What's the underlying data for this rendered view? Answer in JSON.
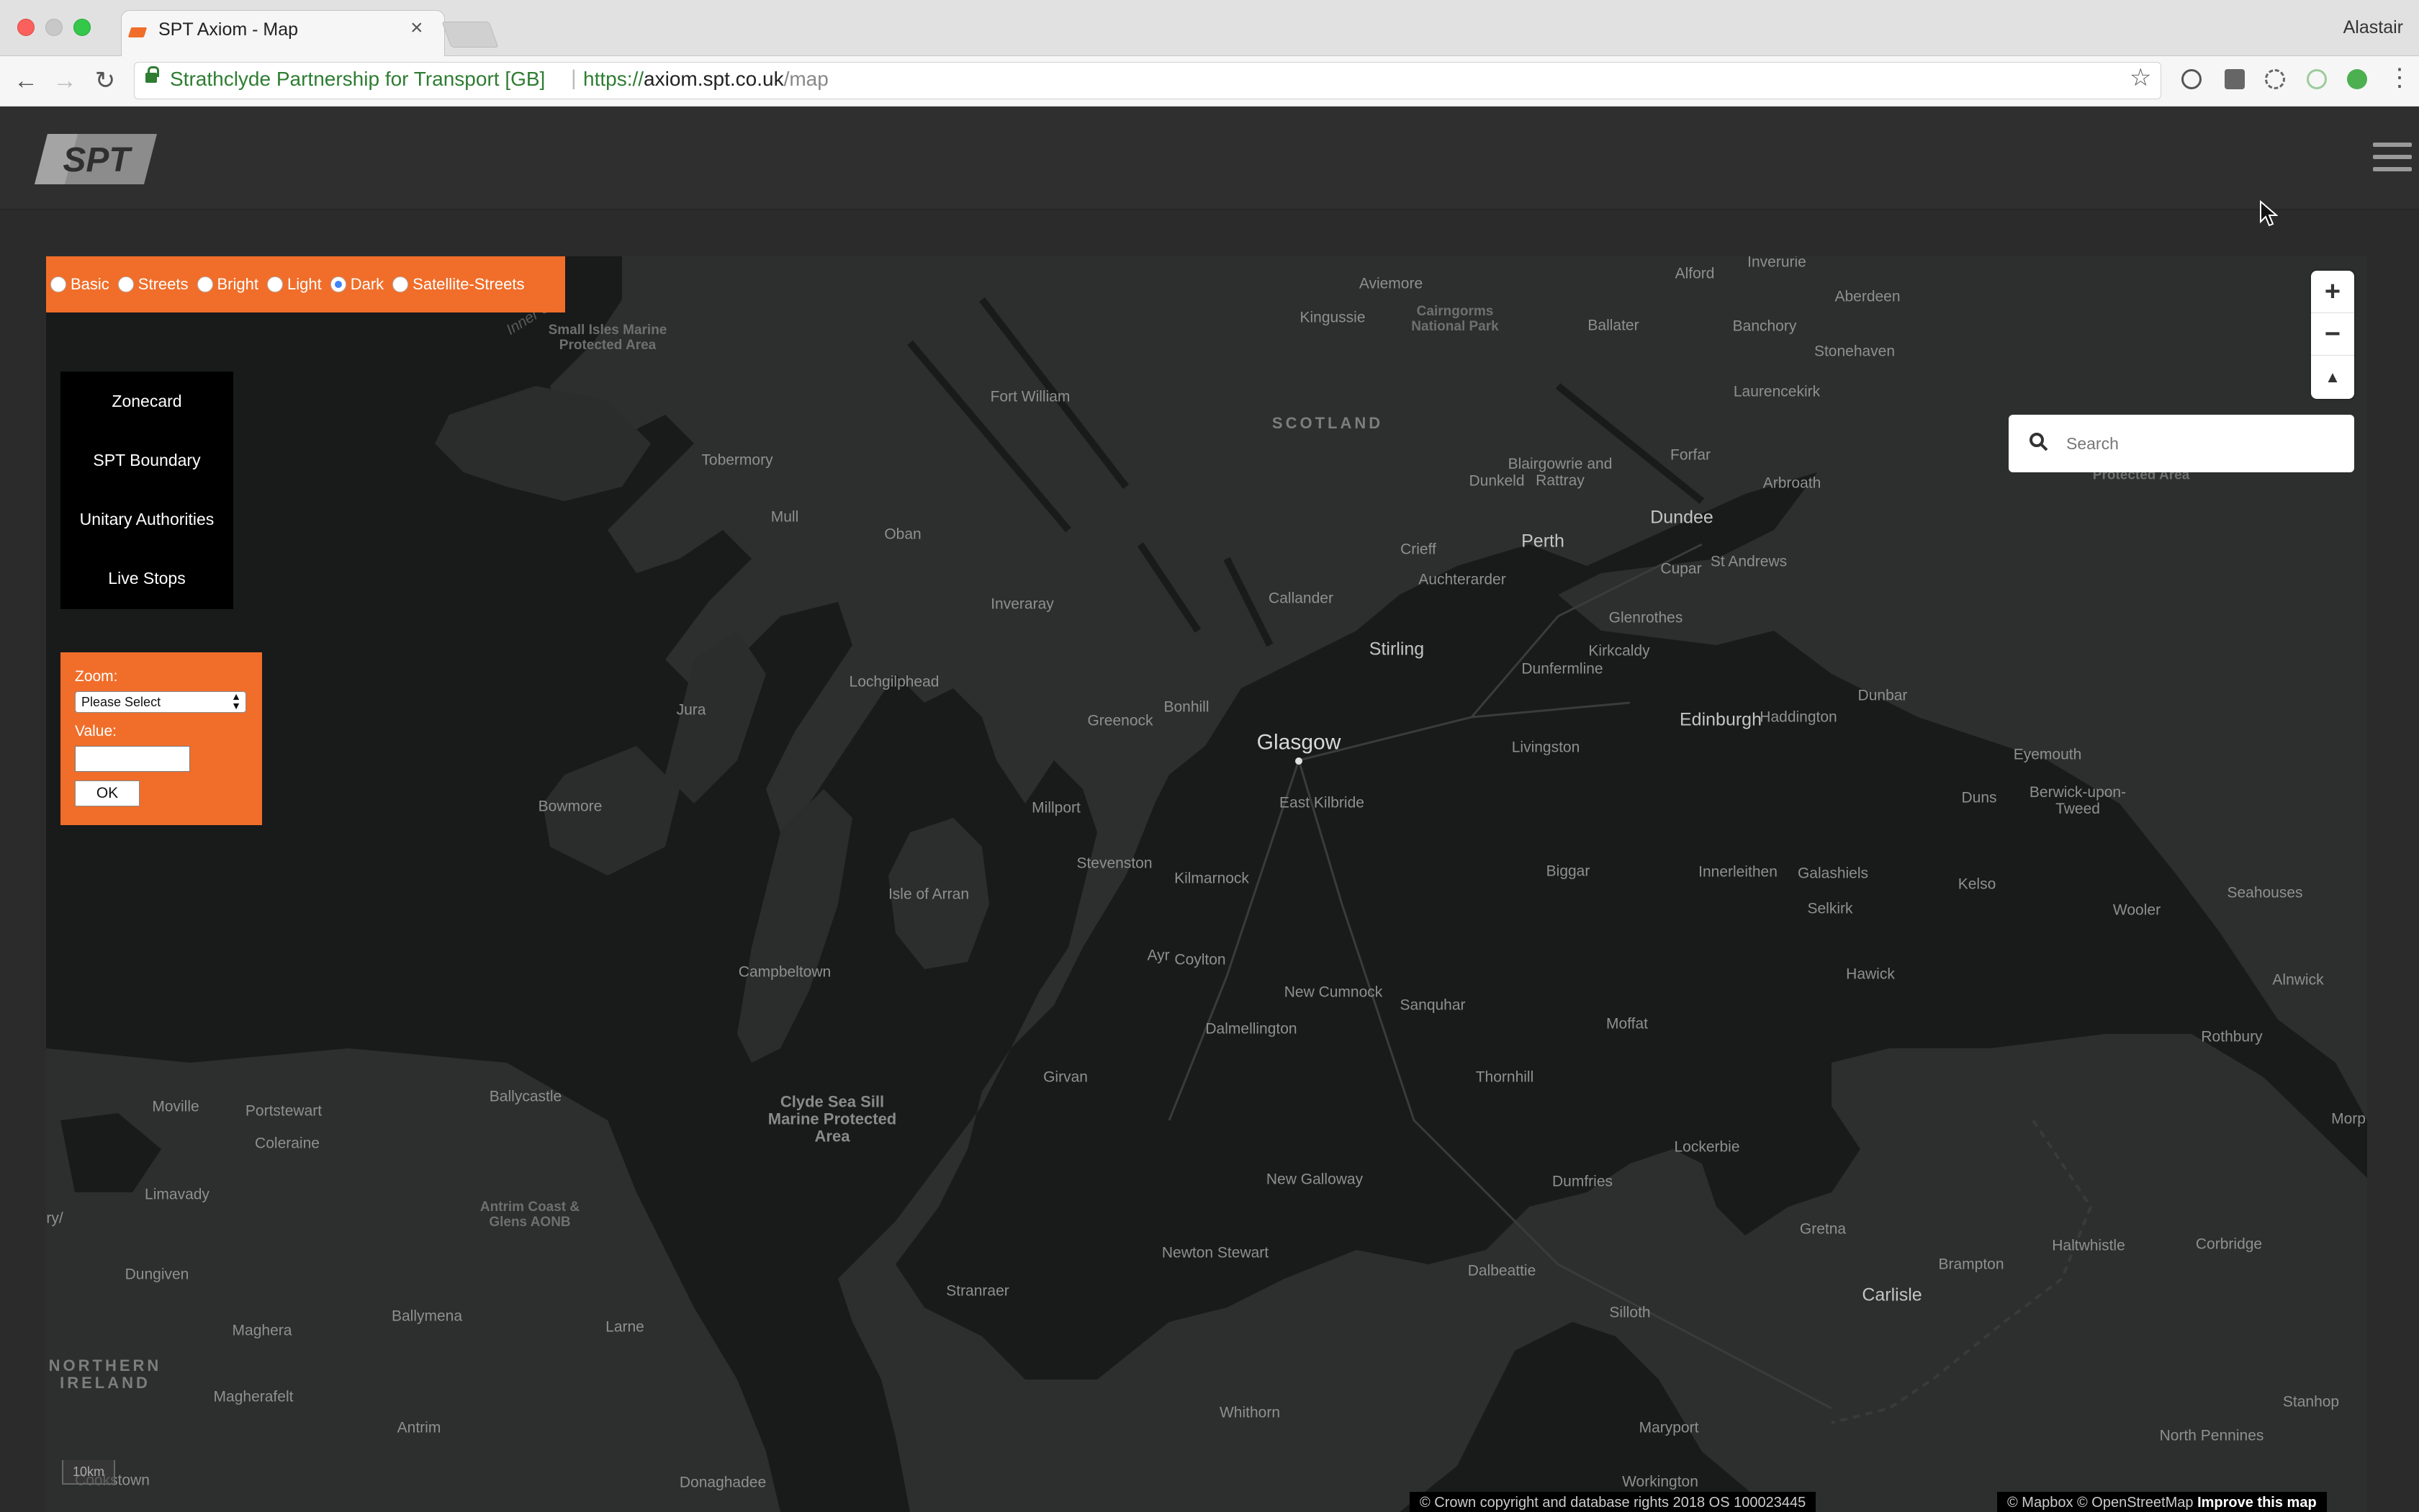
{
  "browser": {
    "tab_title": "SPT Axiom - Map",
    "user": "Alastair",
    "site_identity": "Strathclyde Partnership for Transport [GB]",
    "url_scheme": "https://",
    "url_host": "axiom.spt.co.uk",
    "url_path": "/map"
  },
  "app": {
    "logo_text": "SPT",
    "accent_color": "#f06e2a"
  },
  "map": {
    "styles": [
      {
        "label": "Basic",
        "selected": false
      },
      {
        "label": "Streets",
        "selected": false
      },
      {
        "label": "Bright",
        "selected": false
      },
      {
        "label": "Light",
        "selected": false
      },
      {
        "label": "Dark",
        "selected": true
      },
      {
        "label": "Satellite-Streets",
        "selected": false
      }
    ],
    "layers": [
      "Zonecard",
      "SPT Boundary",
      "Unitary Authorities",
      "Live Stops"
    ],
    "zoom_form": {
      "zoom_label": "Zoom:",
      "zoom_selected": "Please Select",
      "value_label": "Value:",
      "value": "",
      "ok_label": "OK"
    },
    "controls": {
      "zoom_in": "+",
      "zoom_out": "−",
      "compass": "▲"
    },
    "search_placeholder": "Search",
    "scale": "10km",
    "attribution_left": "© Crown copyright and database rights 2018 OS 100023445",
    "attribution_right_plain": "© Mapbox © OpenStreetMap",
    "attribution_right_link": "Improve this map",
    "labels": [
      {
        "text": "Inverurie"
      },
      {
        "text": "Aviemore"
      },
      {
        "text": "Alford"
      },
      {
        "text": "Aberdeen"
      },
      {
        "text": "Kingussie"
      },
      {
        "text": "Cairngorms National Park"
      },
      {
        "text": "Ballater"
      },
      {
        "text": "Banchory"
      },
      {
        "text": "Stonehaven"
      },
      {
        "text": "Small Isles Marine Protected Area"
      },
      {
        "text": "Inner Sea"
      },
      {
        "text": "Fort William"
      },
      {
        "text": "SCOTLAND"
      },
      {
        "text": "Laurencekirk"
      },
      {
        "text": "Tobermory"
      },
      {
        "text": "Blairgowrie and Rattray"
      },
      {
        "text": "Dunkeld"
      },
      {
        "text": "Forfar"
      },
      {
        "text": "Arbroath"
      },
      {
        "text": "Protected Area"
      },
      {
        "text": "Mull"
      },
      {
        "text": "Oban"
      },
      {
        "text": "Perth"
      },
      {
        "text": "Dundee"
      },
      {
        "text": "Crieff"
      },
      {
        "text": "St Andrews"
      },
      {
        "text": "Cupar"
      },
      {
        "text": "Auchterarder"
      },
      {
        "text": "Callander"
      },
      {
        "text": "Inveraray"
      },
      {
        "text": "Glenrothes"
      },
      {
        "text": "Stirling"
      },
      {
        "text": "Kirkcaldy"
      },
      {
        "text": "Dunfermline"
      },
      {
        "text": "Lochgilphead"
      },
      {
        "text": "Dunbar"
      },
      {
        "text": "Bonhill"
      },
      {
        "text": "Jura"
      },
      {
        "text": "Greenock"
      },
      {
        "text": "Haddington"
      },
      {
        "text": "Edinburgh"
      },
      {
        "text": "Glasgow"
      },
      {
        "text": "Livingston"
      },
      {
        "text": "Eyemouth"
      },
      {
        "text": "East Kilbride"
      },
      {
        "text": "Duns"
      },
      {
        "text": "Berwick-upon-Tweed"
      },
      {
        "text": "Bowmore"
      },
      {
        "text": "Millport"
      },
      {
        "text": "Stevenston"
      },
      {
        "text": "Kilmarnock"
      },
      {
        "text": "Biggar"
      },
      {
        "text": "Innerleithen"
      },
      {
        "text": "Galashiels"
      },
      {
        "text": "Isle of Arran"
      },
      {
        "text": "Kelso"
      },
      {
        "text": "Seahouses"
      },
      {
        "text": "Selkirk"
      },
      {
        "text": "Wooler"
      },
      {
        "text": "Ayr"
      },
      {
        "text": "Coylton"
      },
      {
        "text": "Campbeltown"
      },
      {
        "text": "Hawick"
      },
      {
        "text": "Alnwick"
      },
      {
        "text": "New Cumnock"
      },
      {
        "text": "Sanquhar"
      },
      {
        "text": "Dalmellington"
      },
      {
        "text": "Moffat"
      },
      {
        "text": "Rothbury"
      },
      {
        "text": "Girvan"
      },
      {
        "text": "Thornhill"
      },
      {
        "text": "Ballycastle"
      },
      {
        "text": "Moville"
      },
      {
        "text": "Portstewart"
      },
      {
        "text": "Clyde Sea Sill Marine Protected Area"
      },
      {
        "text": "Morp"
      },
      {
        "text": "Coleraine"
      },
      {
        "text": "Lockerbie"
      },
      {
        "text": "New Galloway"
      },
      {
        "text": "Dumfries"
      },
      {
        "text": "Limavady"
      },
      {
        "text": "Antrim Coast & Glens AONB"
      },
      {
        "text": "Gretna"
      },
      {
        "text": "ry/"
      },
      {
        "text": "Haltwhistle"
      },
      {
        "text": "Corbridge"
      },
      {
        "text": "Newton Stewart"
      },
      {
        "text": "Brampton"
      },
      {
        "text": "Dungiven"
      },
      {
        "text": "Dalbeattie"
      },
      {
        "text": "Stranraer"
      },
      {
        "text": "Carlisle"
      },
      {
        "text": "Ballymena"
      },
      {
        "text": "Silloth"
      },
      {
        "text": "Maghera"
      },
      {
        "text": "Larne"
      },
      {
        "text": "NORTHERN IRELAND"
      },
      {
        "text": "Magherafelt"
      },
      {
        "text": "Stanhop"
      },
      {
        "text": "Whithorn"
      },
      {
        "text": "Antrim"
      },
      {
        "text": "Maryport"
      },
      {
        "text": "North Pennines"
      },
      {
        "text": "Cookstown"
      },
      {
        "text": "Donaghadee"
      },
      {
        "text": "Workington"
      }
    ]
  }
}
